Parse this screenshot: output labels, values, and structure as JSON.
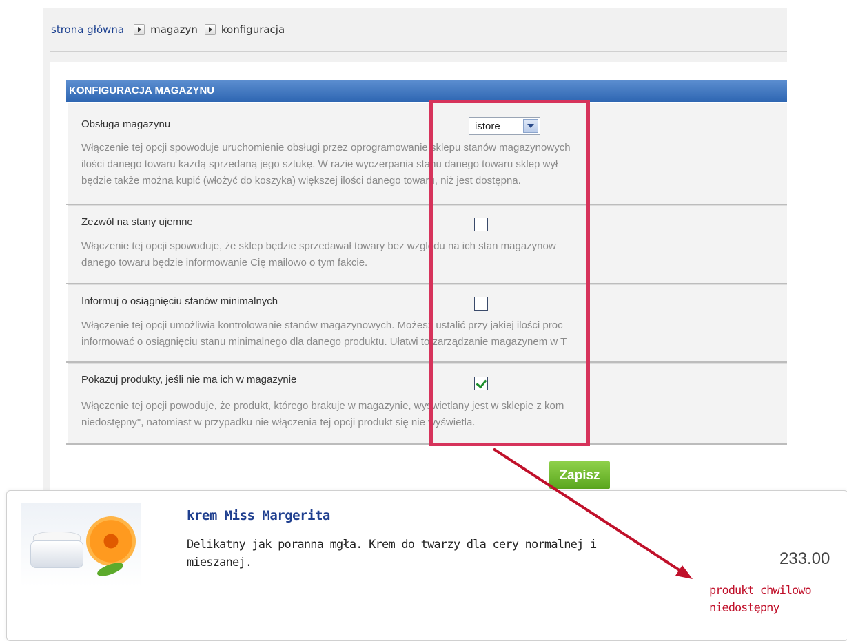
{
  "breadcrumb": {
    "home": "strona główna",
    "items": [
      "magazyn",
      "konfiguracja"
    ]
  },
  "panel": {
    "title": "KONFIGURACJA MAGAZYNU",
    "rows": [
      {
        "label": "Obsługa magazynu",
        "control": "select",
        "select_value": "istore",
        "desc": [
          "Włączenie tej opcji spowoduje uruchomienie obsługi przez oprogramowanie sklepu stanów magazynowych",
          "ilości danego towaru każdą sprzedaną jego sztukę. W razie wyczerpania stanu danego towaru sklep wył",
          "będzie także można kupić (włożyć do koszyka) większej ilości danego towaru, niż jest dostępna."
        ]
      },
      {
        "label": "Zezwól na stany ujemne",
        "control": "checkbox",
        "checked": false,
        "desc": [
          "Włączenie tej opcji spowoduje, że sklep będzie sprzedawał towary bez względu na ich stan magazynow",
          "danego towaru będzie informowanie Cię mailowo o tym fakcie."
        ]
      },
      {
        "label": "Informuj o osiągnięciu stanów minimalnych",
        "control": "checkbox",
        "checked": false,
        "desc": [
          "Włączenie tej opcji umożliwia kontrolowanie stanów magazynowych. Możesz ustalić przy jakiej ilości proc",
          "informować o osiągnięciu stanu minimalnego dla danego produktu. Ułatwi to zarządzanie magazynem w T"
        ]
      },
      {
        "label": "Pokazuj produkty, jeśli nie ma ich w magazynie",
        "control": "checkbox",
        "checked": true,
        "desc": [
          "Włączenie tej opcji powoduje, że produkt, którego brakuje w magazynie, wyświetlany jest w sklepie z kom",
          "niedostępny\", natomiast w przypadku nie włączenia tej opcji produkt się nie wyświetla."
        ]
      }
    ],
    "save_label": "Zapisz"
  },
  "product": {
    "name": "krem Miss Margerita",
    "description": "Delikatny jak poranna mgła. Krem do twarzy dla cery normalnej i mieszanej.",
    "price": "233.00",
    "status": "produkt chwilowo niedostępny"
  },
  "colors": {
    "header_blue": "#2e66b2",
    "highlight": "#d6335b",
    "arrow": "#c0102a",
    "save_green": "#5aa61e",
    "link_blue": "#1a3f8f"
  }
}
